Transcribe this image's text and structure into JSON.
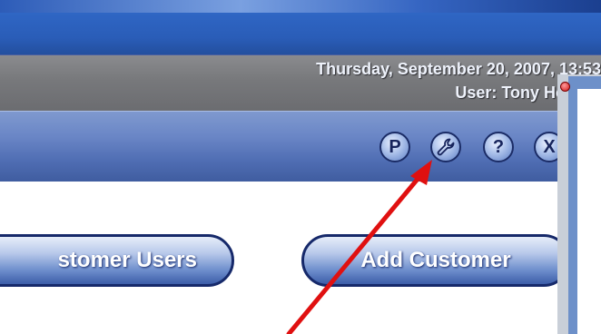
{
  "header": {
    "datetime": "Thursday, September 20, 2007, 13:53",
    "user": "User: Tony Hoffhin"
  },
  "toolbar": {
    "icons": [
      {
        "name": "p-icon",
        "glyph": "P"
      },
      {
        "name": "wrench-icon",
        "glyph": ""
      },
      {
        "name": "help-icon",
        "glyph": "?"
      },
      {
        "name": "close-icon",
        "glyph": "X"
      }
    ]
  },
  "main": {
    "customer_users_label": "stomer Users",
    "add_customer_label": "Add Customer"
  },
  "colors": {
    "annotation_arrow": "#e01010",
    "header_bar": "#77787b",
    "toolbar": "#5f7cc0"
  }
}
